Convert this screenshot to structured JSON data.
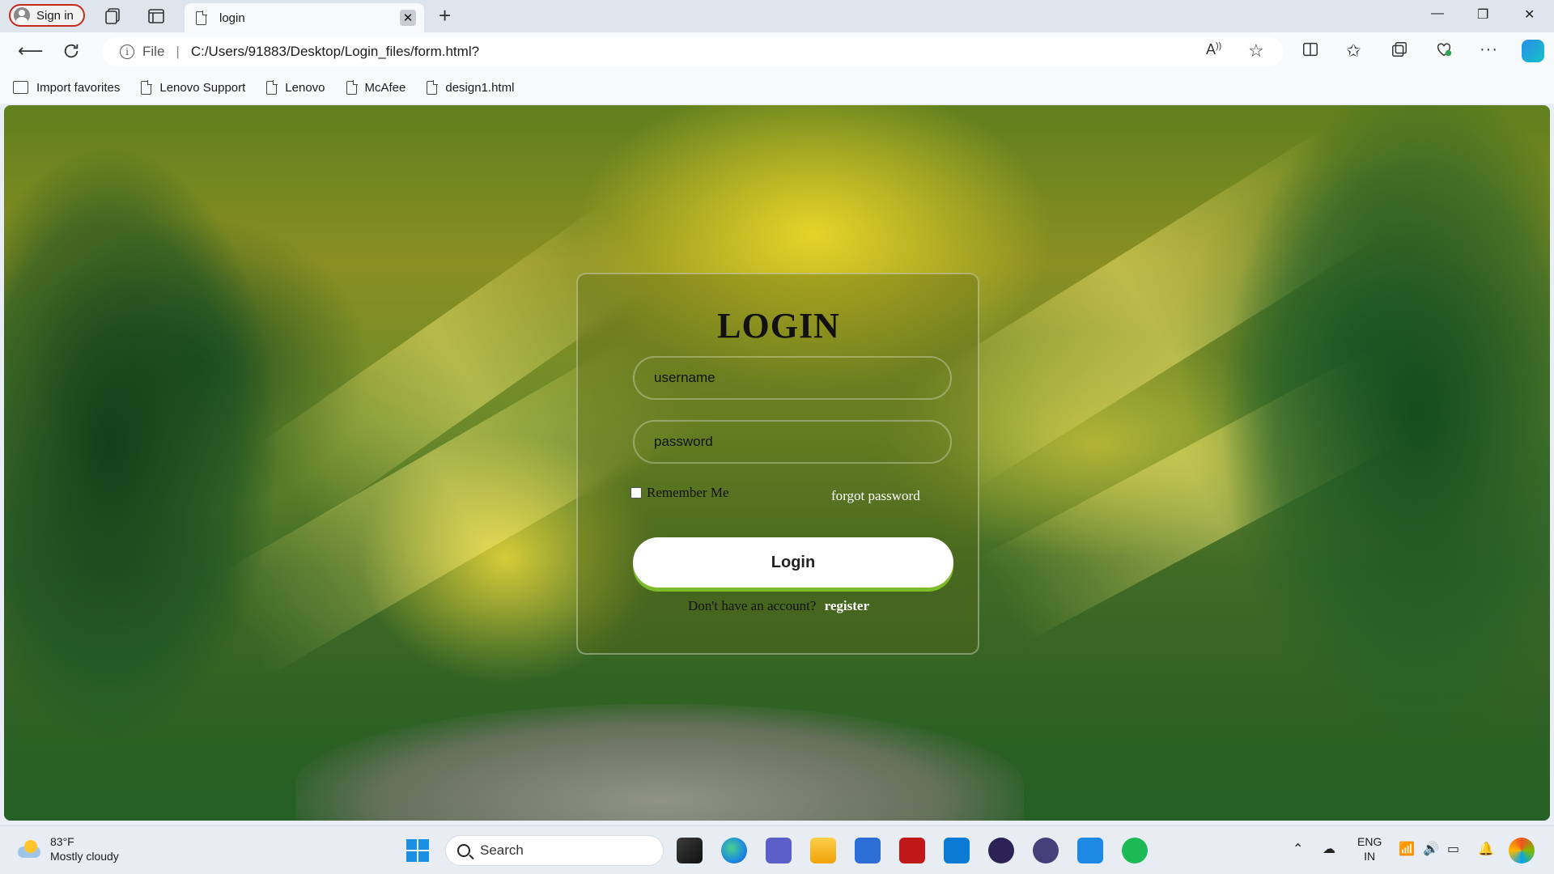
{
  "browser": {
    "signin_label": "Sign in",
    "tab_title": "login",
    "tab_close": "✕",
    "new_tab": "+",
    "window_controls": {
      "minimize": "—",
      "maximize": "❐",
      "close": "✕"
    },
    "address": {
      "scheme_label": "File",
      "separator": "|",
      "url": "C:/Users/91883/Desktop/Login_files/form.html?"
    },
    "favorites": [
      {
        "label": "Import favorites",
        "icon": "import-icon"
      },
      {
        "label": "Lenovo Support",
        "icon": "page-icon"
      },
      {
        "label": "Lenovo",
        "icon": "page-icon"
      },
      {
        "label": "McAfee",
        "icon": "page-icon"
      },
      {
        "label": "design1.html",
        "icon": "page-icon"
      }
    ]
  },
  "page": {
    "title": "LOGIN",
    "username_placeholder": "username",
    "password_placeholder": "password",
    "remember_label": "Remember Me",
    "remember_checked": false,
    "forgot_label": "forgot password",
    "login_button": "Login",
    "no_account_text": "Don't have an account?",
    "register_label": "register"
  },
  "taskbar": {
    "weather_temp": "83°F",
    "weather_desc": "Mostly cloudy",
    "search_label": "Search",
    "lang_top": "ENG",
    "lang_bottom": "IN"
  },
  "colors": {
    "accent_button_shadow": "#7dbb2a",
    "signin_border": "#c42b1c",
    "link_white": "#ffffff"
  }
}
